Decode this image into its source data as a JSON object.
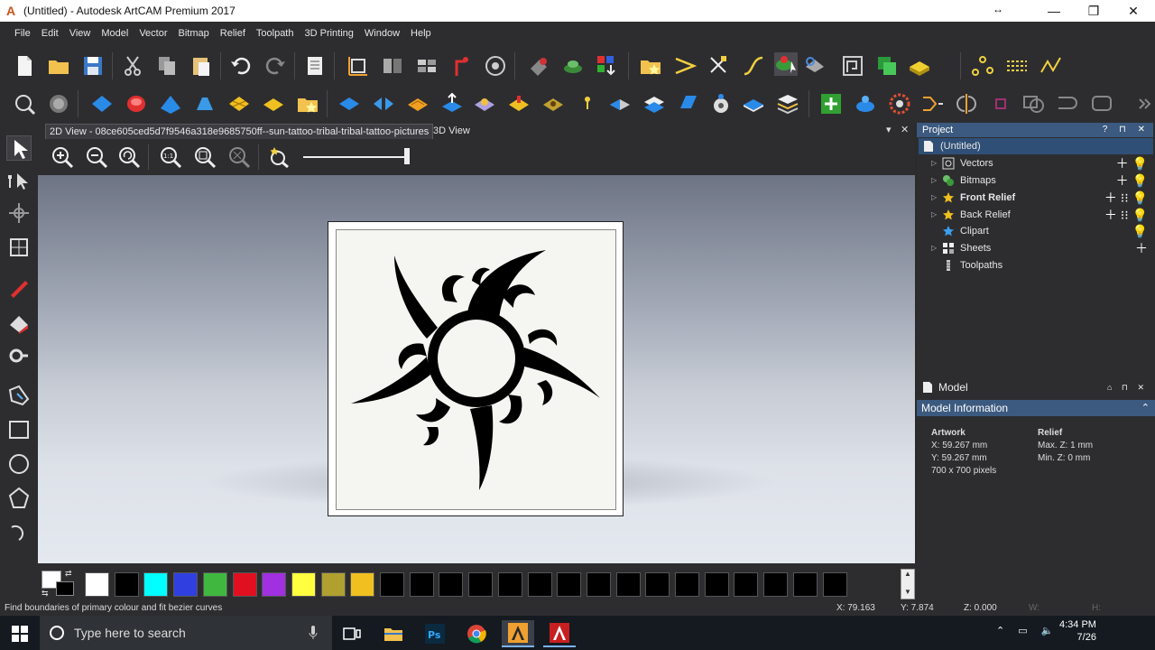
{
  "window": {
    "title": "(Untitled) - Autodesk ArtCAM Premium 2017",
    "logo_glyph": "A",
    "resize_glyph": "↔",
    "minimize_glyph": "—",
    "maximize_glyph": "❐",
    "close_glyph": "✕"
  },
  "menu": [
    "File",
    "Edit",
    "View",
    "Model",
    "Vector",
    "Bitmap",
    "Relief",
    "Toolpath",
    "3D Printing",
    "Window",
    "Help"
  ],
  "tabs": {
    "view2d": "2D View - 08ce605ced5d7f9546a318e9685750ff--sun-tattoo-tribal-tribal-tattoo-pictures",
    "view3d": "3D View",
    "pin_glyph": "▾",
    "close_glyph": "✕"
  },
  "project": {
    "title": "Project",
    "buttons": "? ⊓ ✕",
    "items": [
      {
        "label": "(Untitled)",
        "bold": false
      },
      {
        "label": "Vectors",
        "bold": false
      },
      {
        "label": "Bitmaps",
        "bold": false
      },
      {
        "label": "Front Relief",
        "bold": true
      },
      {
        "label": "Back Relief",
        "bold": false
      },
      {
        "label": "Clipart",
        "bold": false
      },
      {
        "label": "Sheets",
        "bold": false
      },
      {
        "label": "Toolpaths",
        "bold": false
      }
    ]
  },
  "model": {
    "label": "Model",
    "info_title": "Model Information",
    "artwork_header": "Artwork",
    "artwork_x": "X: 59.267 mm",
    "artwork_y": "Y: 59.267 mm",
    "artwork_px": "700 x 700 pixels",
    "relief_header": "Relief",
    "relief_max": "Max. Z: 1 mm",
    "relief_min": "Min. Z: 0 mm"
  },
  "status": {
    "message": "Find boundaries of primary colour and fit bezier curves",
    "x": "X: 79.163",
    "y": "Y: 7.874",
    "z": "Z: 0.000",
    "w": "W:",
    "h": "H:"
  },
  "taskbar": {
    "search_placeholder": "Type here to search",
    "time": "4:34 PM",
    "date": "7/26"
  },
  "palette_colors": [
    "#ffffff",
    "#000000",
    "#00ffff",
    "#3040e0",
    "#40b840",
    "#e01020",
    "#a030e0",
    "#ffff40",
    "#b0a030",
    "#f0c020",
    "#000000",
    "#000000",
    "#000000",
    "#000000",
    "#000000",
    "#000000",
    "#000000",
    "#000000",
    "#000000",
    "#000000",
    "#000000",
    "#000000",
    "#000000",
    "#000000",
    "#000000",
    "#000000"
  ]
}
